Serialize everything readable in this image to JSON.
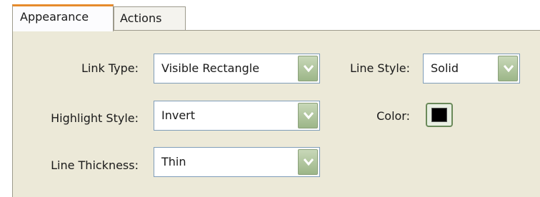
{
  "tabs": [
    {
      "label": "Appearance",
      "active": true
    },
    {
      "label": "Actions",
      "active": false
    }
  ],
  "fields": {
    "link_type": {
      "label": "Link Type:",
      "value": "Visible Rectangle"
    },
    "line_style": {
      "label": "Line Style:",
      "value": "Solid"
    },
    "highlight_style": {
      "label": "Highlight Style:",
      "value": "Invert"
    },
    "color": {
      "label": "Color:",
      "value": "#000000"
    },
    "line_thickness": {
      "label": "Line Thickness:",
      "value": "Thin"
    }
  },
  "colors": {
    "active_tab_accent": "#e68b2c",
    "panel_background": "#ece9d8",
    "dropdown_button": "#9cb688"
  }
}
